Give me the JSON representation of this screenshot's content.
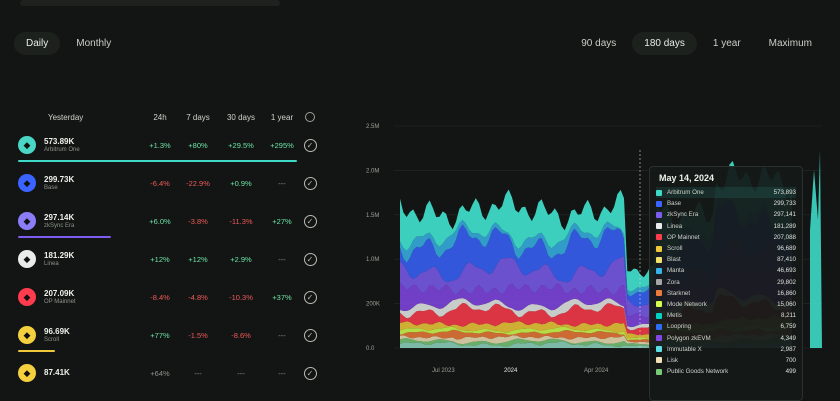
{
  "periods": {
    "daily": "Daily",
    "monthly": "Monthly"
  },
  "ranges": {
    "r90": "90 days",
    "r180": "180 days",
    "r1y": "1 year",
    "max": "Maximum"
  },
  "table": {
    "headers": {
      "name": "Yesterday",
      "c24h": "24h",
      "c7d": "7 days",
      "c30d": "30 days",
      "c1y": "1 year"
    },
    "rows": [
      {
        "icon": "arbitrum-logo-icon",
        "color": "#4ad6c4",
        "value": "573.89K",
        "subtitle": "Arbitrum One",
        "c24h": "+1.3%",
        "c7d": "+80%",
        "c30d": "+29.5%",
        "c1y": "+295%",
        "s24h": "pos",
        "s7d": "pos",
        "s30d": "pos",
        "s1y": "pos",
        "bar": "#3fd9c7",
        "bar_fraction": 0.9
      },
      {
        "icon": "base-logo-icon",
        "color": "#3a63ff",
        "value": "299.73K",
        "subtitle": "Base",
        "c24h": "-6.4%",
        "c7d": "-22.9%",
        "c30d": "+0.9%",
        "c1y": "---",
        "s24h": "neg",
        "s7d": "neg",
        "s30d": "pos",
        "s1y": "neu",
        "bar": "#3a63ff",
        "bar_fraction": 0
      },
      {
        "icon": "zksync-logo-icon",
        "color": "#8b7cf8",
        "value": "297.14K",
        "subtitle": "zkSync Era",
        "c24h": "+6.0%",
        "c7d": "-3.8%",
        "c30d": "-11.3%",
        "c1y": "+27%",
        "s24h": "pos",
        "s7d": "neg",
        "s30d": "neg",
        "s1y": "pos",
        "bar": "#7d5cf0",
        "bar_fraction": 0.3
      },
      {
        "icon": "linea-logo-icon",
        "color": "#e9ecea",
        "value": "181.29K",
        "subtitle": "Linea",
        "c24h": "+12%",
        "c7d": "+12%",
        "c30d": "+2.9%",
        "c1y": "---",
        "s24h": "pos",
        "s7d": "pos",
        "s30d": "pos",
        "s1y": "neu",
        "bar": "#e9ecea",
        "bar_fraction": 0
      },
      {
        "icon": "op-mainnet-logo-icon",
        "color": "#ff3b4e",
        "value": "207.09K",
        "subtitle": "OP Mainnet",
        "c24h": "-8.4%",
        "c7d": "-4.8%",
        "c30d": "-10.3%",
        "c1y": "+37%",
        "s24h": "neg",
        "s7d": "neg",
        "s30d": "neg",
        "s1y": "pos",
        "bar": "#ff3b4e",
        "bar_fraction": 0
      },
      {
        "icon": "scroll-logo-icon",
        "color": "#f4d03f",
        "value": "96.69K",
        "subtitle": "Scroll",
        "c24h": "+77%",
        "c7d": "-1.5%",
        "c30d": "-8.6%",
        "c1y": "---",
        "s24h": "pos",
        "s7d": "neg",
        "s30d": "neg",
        "s1y": "neu",
        "bar": "#f0c93a",
        "bar_fraction": 0.12
      },
      {
        "icon": "taiko-logo-icon",
        "color": "#f4d03f",
        "value": "87.41K",
        "subtitle": "",
        "c24h": "+64%",
        "c7d": "---",
        "c30d": "---",
        "c1y": "---",
        "s24h": "neu",
        "s7d": "neu",
        "s30d": "neu",
        "s1y": "neu",
        "bar": "#f0c93a",
        "bar_fraction": 0
      }
    ]
  },
  "chart_data": {
    "type": "area",
    "stacked": true,
    "y_ticks": [
      "0.0",
      "200K",
      "1.0M",
      "1.5M",
      "2.0M",
      "2.5M"
    ],
    "x_ticks": [
      "Jul 2023",
      "2024",
      "Apr 2024"
    ],
    "grid": true
  },
  "tooltip": {
    "date": "May 14, 2024",
    "items": [
      {
        "name": "Arbitrum One",
        "value": "573,893",
        "color": "#3fd9c7"
      },
      {
        "name": "Base",
        "value": "299,733",
        "color": "#3a63ff"
      },
      {
        "name": "zkSync Era",
        "value": "297,141",
        "color": "#7d5cf0"
      },
      {
        "name": "Linea",
        "value": "181,289",
        "color": "#e9ecea"
      },
      {
        "name": "OP Mainnet",
        "value": "207,088",
        "color": "#ff3b4e"
      },
      {
        "name": "Scroll",
        "value": "96,689",
        "color": "#f0c93a"
      },
      {
        "name": "Blast",
        "value": "87,410",
        "color": "#f4e36a"
      },
      {
        "name": "Manta",
        "value": "46,693",
        "color": "#36b4e8"
      },
      {
        "name": "Zora",
        "value": "29,802",
        "color": "#a6a6a6"
      },
      {
        "name": "Starknet",
        "value": "16,860",
        "color": "#ec7a3a"
      },
      {
        "name": "Mode Network",
        "value": "15,060",
        "color": "#d4ff4f"
      },
      {
        "name": "Metis",
        "value": "8,211",
        "color": "#00d4bf"
      },
      {
        "name": "Loopring",
        "value": "6,759",
        "color": "#2e6df6"
      },
      {
        "name": "Polygon zkEVM",
        "value": "4,349",
        "color": "#8247e5"
      },
      {
        "name": "Immutable X",
        "value": "2,987",
        "color": "#5ce0e6"
      },
      {
        "name": "Lisk",
        "value": "700",
        "color": "#f0e0b6"
      },
      {
        "name": "Public Goods Network",
        "value": "499",
        "color": "#78c979"
      }
    ]
  }
}
